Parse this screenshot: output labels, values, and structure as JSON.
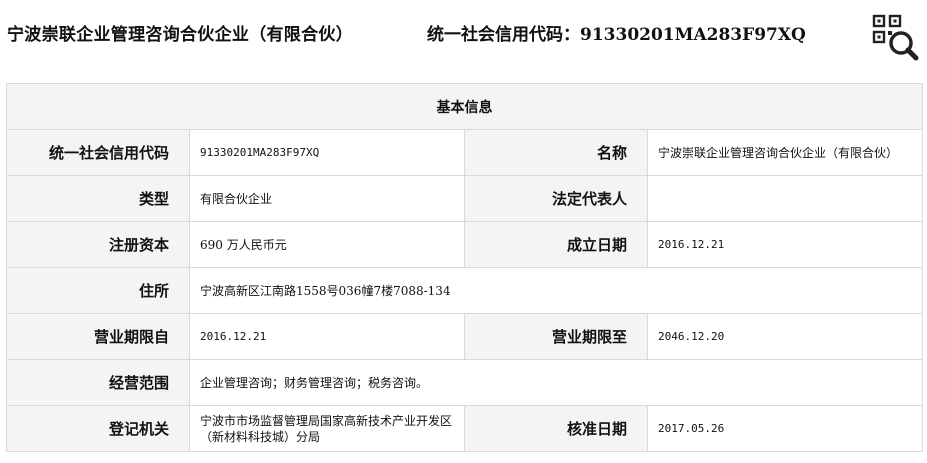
{
  "header": {
    "company_name": "宁波崇联企业管理咨询合伙企业（有限合伙）",
    "credit_code_label": "统一社会信用代码：91330201MA283F97XQ"
  },
  "table": {
    "title": "基本信息",
    "rows": [
      {
        "l1": "统一社会信用代码",
        "v1": "91330201MA283F97XQ",
        "l2": "名称",
        "v2": "宁波崇联企业管理咨询合伙企业（有限合伙）"
      },
      {
        "l1": "类型",
        "v1": "有限合伙企业",
        "l2": "法定代表人",
        "v2": ""
      },
      {
        "l1": "注册资本",
        "v1": "690 万人民币元",
        "l2": "成立日期",
        "v2": "2016.12.21"
      },
      {
        "l1": "住所",
        "v1": "宁波高新区江南路1558号036幢7楼7088-134"
      },
      {
        "l1": "营业期限自",
        "v1": "2016.12.21",
        "l2": "营业期限至",
        "v2": "2046.12.20"
      },
      {
        "l1": "经营范围",
        "v1": "企业管理咨询；财务管理咨询；税务咨询。"
      },
      {
        "l1": "登记机关",
        "v1": "宁波市市场监督管理局国家高新技术产业开发区（新材料科技城）分局",
        "l2": "核准日期",
        "v2": "2017.05.26"
      }
    ]
  },
  "icons": {
    "qr_search": "qr-code-search-icon"
  }
}
